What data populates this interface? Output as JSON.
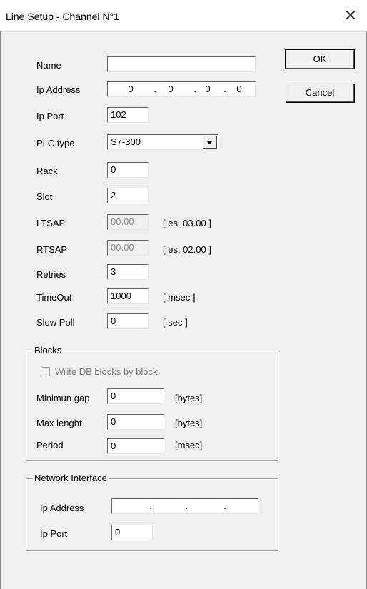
{
  "window": {
    "title": "Line Setup - Channel N°1",
    "close_glyph": "✕"
  },
  "buttons": {
    "ok": "OK",
    "cancel": "Cancel"
  },
  "fields": {
    "name": {
      "label": "Name",
      "value": ""
    },
    "ip_address": {
      "label": "Ip Address",
      "octets": [
        "0",
        "0",
        "0",
        "0"
      ]
    },
    "ip_port": {
      "label": "Ip Port",
      "value": "102"
    },
    "plc_type": {
      "label": "PLC type",
      "value": "S7-300"
    },
    "rack": {
      "label": "Rack",
      "value": "0"
    },
    "slot": {
      "label": "Slot",
      "value": "2"
    },
    "ltsap": {
      "label": "LTSAP",
      "value": "00.00",
      "hint": "[ es. 03.00 ]"
    },
    "rtsap": {
      "label": "RTSAP",
      "value": "00.00",
      "hint": "[ es. 02.00 ]"
    },
    "retries": {
      "label": "Retries",
      "value": "3"
    },
    "timeout": {
      "label": "TimeOut",
      "value": "1000",
      "unit": "[ msec ]"
    },
    "slow_poll": {
      "label": "Slow Poll",
      "value": "0",
      "unit": "[ sec ]"
    }
  },
  "blocks": {
    "title": "Blocks",
    "write_db": {
      "label": "Write DB blocks by block",
      "checked": false,
      "enabled": false
    },
    "min_gap": {
      "label": "Minimun gap",
      "value": "0",
      "unit": "[bytes]"
    },
    "max_length": {
      "label": "Max lenght",
      "value": "0",
      "unit": "[bytes]"
    },
    "period": {
      "label": "Period",
      "value": "0",
      "unit": "[msec]"
    }
  },
  "network": {
    "title": "Network Interface",
    "ip_address": {
      "label": "Ip Address",
      "octets": [
        "",
        "",
        "",
        ""
      ]
    },
    "ip_port": {
      "label": "Ip Port",
      "value": "0"
    }
  }
}
